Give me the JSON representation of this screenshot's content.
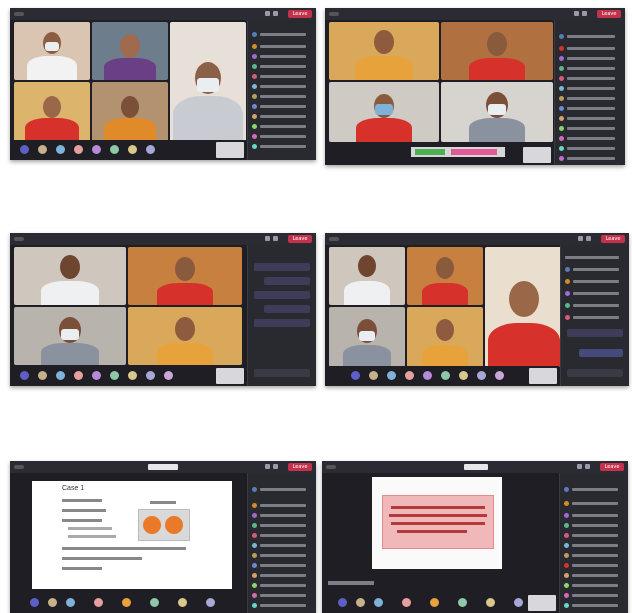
{
  "screens": [
    {
      "id": "top-left",
      "leave_label": "Leave"
    },
    {
      "id": "top-right",
      "leave_label": "Leave"
    },
    {
      "id": "mid-left",
      "leave_label": "Leave"
    },
    {
      "id": "mid-right",
      "leave_label": "Leave"
    },
    {
      "id": "bottom-left",
      "leave_label": "Leave"
    },
    {
      "id": "bottom-right",
      "leave_label": "Leave"
    }
  ],
  "slide": {
    "title": "Case 1"
  },
  "icons": [
    "mic-icon",
    "camera-icon",
    "share-icon",
    "participants-icon",
    "chat-icon"
  ],
  "colors": {
    "leave": "#c4314b",
    "teams_dark": "#1e1e24",
    "sidebar": "#292930",
    "shirt_red": "#d6312b",
    "shirt_blue": "#5b7bb7"
  }
}
